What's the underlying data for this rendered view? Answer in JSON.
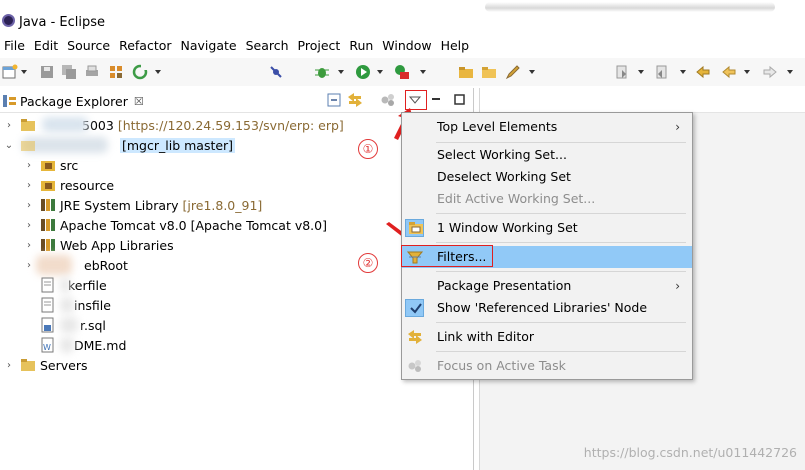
{
  "window": {
    "title": "Java - Eclipse"
  },
  "menubar": [
    "File",
    "Edit",
    "Source",
    "Refactor",
    "Navigate",
    "Search",
    "Project",
    "Run",
    "Window",
    "Help"
  ],
  "view": {
    "tab_label": "Package Explorer",
    "close_glyph": "☒"
  },
  "tree": {
    "svn_project": {
      "name_visible": "5003",
      "decoration": "[https://120.24.59.153/svn/erp: erp]"
    },
    "git_project": {
      "decoration": "[mgcr_lib master]"
    },
    "children": [
      {
        "label": "src",
        "icon": "source-folder-icon"
      },
      {
        "label": "resource",
        "icon": "source-folder-icon"
      },
      {
        "label": "JRE System Library",
        "decoration": "[jre1.8.0_91]",
        "icon": "library-icon"
      },
      {
        "label": "Apache Tomcat v8.0 [Apache Tomcat v8.0]",
        "icon": "library-icon"
      },
      {
        "label": "Web App Libraries",
        "icon": "library-icon"
      },
      {
        "label": "ebRoot",
        "icon": "folder-icon"
      },
      {
        "label": "kerfile",
        "icon": "file-icon"
      },
      {
        "label": "insfile",
        "icon": "file-icon"
      },
      {
        "label": "r.sql",
        "icon": "sql-file-icon"
      },
      {
        "label": "DME.md",
        "icon": "markdown-file-icon"
      }
    ],
    "servers": {
      "label": "Servers"
    }
  },
  "view_menu": {
    "items": [
      {
        "label": "Top Level Elements",
        "submenu": "›",
        "enabled": true
      },
      {
        "label": "Select Working Set...",
        "enabled": true
      },
      {
        "label": "Deselect Working Set",
        "enabled": true
      },
      {
        "label": "Edit Active Working Set...",
        "enabled": false
      },
      {
        "label": "1 Window Working Set",
        "enabled": true
      },
      {
        "label": "Filters...",
        "enabled": true,
        "highlighted": true
      },
      {
        "label": "Package Presentation",
        "submenu": "›",
        "enabled": true
      },
      {
        "label": "Show 'Referenced Libraries' Node",
        "enabled": true,
        "checked": true
      },
      {
        "label": "Link with Editor",
        "enabled": true
      },
      {
        "label": "Focus on Active Task",
        "enabled": false
      }
    ]
  },
  "annotations": {
    "step1": "①",
    "step2": "②"
  },
  "watermark": "https://blog.csdn.net/u011442726",
  "colors": {
    "highlight": "#91c9f7",
    "selection": "#cde8ff",
    "annotation_red": "#e02020",
    "decoration_brown": "#8a6a34"
  }
}
